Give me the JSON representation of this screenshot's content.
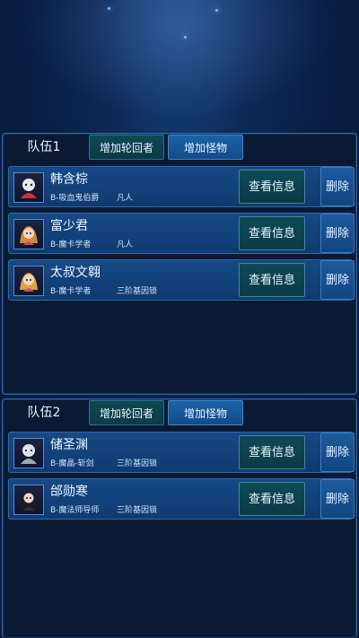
{
  "panels": [
    {
      "title": "队伍1",
      "tab_add_reincarnator": "增加轮回者",
      "tab_add_monster": "增加怪物",
      "members": [
        {
          "name": "韩含棕",
          "class": "B-吸血鬼伯爵",
          "level": "凡人",
          "info": "查看信息",
          "delete": "删除"
        },
        {
          "name": "富少君",
          "class": "B-魔卡学者",
          "level": "凡人",
          "info": "查看信息",
          "delete": "删除"
        },
        {
          "name": "太叔文翱",
          "class": "B-魔卡学者",
          "level": "三阶基因锁",
          "info": "查看信息",
          "delete": "删除"
        }
      ]
    },
    {
      "title": "队伍2",
      "tab_add_reincarnator": "增加轮回者",
      "tab_add_monster": "增加怪物",
      "members": [
        {
          "name": "储圣渊",
          "class": "B-魔晶-斩剑",
          "level": "三阶基因锁",
          "info": "查看信息",
          "delete": "删除"
        },
        {
          "name": "邰勋寒",
          "class": "B-魔法师导师",
          "level": "三阶基因锁",
          "info": "查看信息",
          "delete": "删除"
        }
      ]
    }
  ],
  "icons": [
    "character-avatar-icon"
  ]
}
